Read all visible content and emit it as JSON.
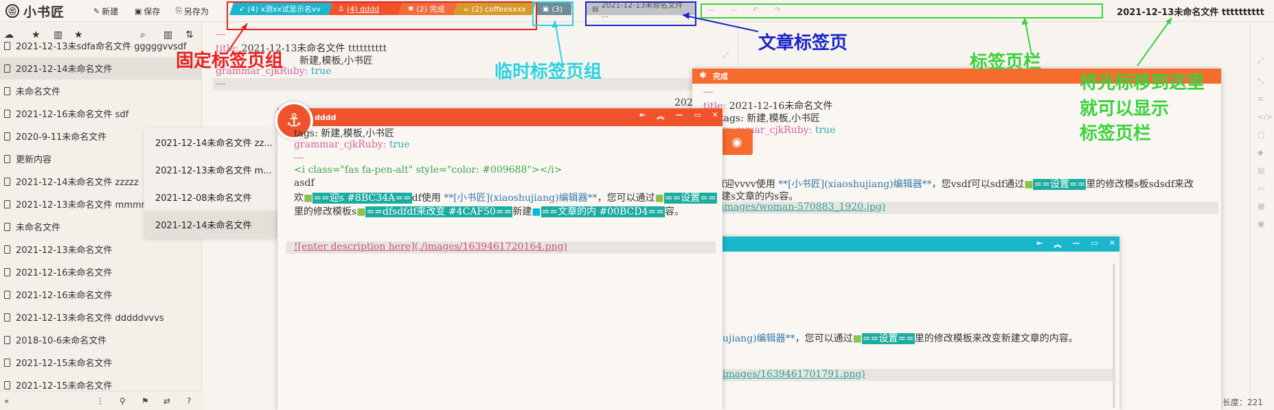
{
  "app": {
    "name": "小书匠",
    "logo_glyph": "㊂"
  },
  "toolbar": {
    "new_label": "新建",
    "save_label": "保存",
    "saveas_label": "另存为"
  },
  "tabs": [
    {
      "label": "(4) x测xx试显示名vv",
      "icon": "rocket-icon",
      "color": "#1bb5cc"
    },
    {
      "label": "(4) dddd",
      "icon": "anchor-icon",
      "color": "#f0522b"
    },
    {
      "label": "(2) 完成",
      "icon": "gear-icon",
      "color": "#f56a3c"
    },
    {
      "label": "(2) coffeexxxx",
      "icon": "coffee-icon",
      "color": "#d69a2a"
    },
    {
      "label": "(3)",
      "icon": "save-icon",
      "color": "#6e8c9a"
    },
    {
      "label": "2021-12-13未命名文件 ...",
      "icon": "file-icon",
      "color": "#bfc2c6"
    }
  ],
  "document_title": "2021-12-13未命名文件 tttttttttt",
  "sidebar": {
    "files": [
      {
        "label": "2021-12-13未sdfa命名文件 gggggvvsdf",
        "selected": false
      },
      {
        "label": "2021-12-14未命名文件",
        "selected": true
      },
      {
        "label": "未命名文件",
        "selected": false
      },
      {
        "label": "2021-12-16未命名文件 sdf",
        "selected": false
      },
      {
        "label": "2020-9-11未命名文件",
        "selected": false
      },
      {
        "label": "更新内容",
        "selected": false
      },
      {
        "label": "2021-12-14未命名文件 zzzzz",
        "selected": false
      },
      {
        "label": "2021-12-13未命名文件 mmmm",
        "selected": false
      },
      {
        "label": "未命名文件",
        "selected": false
      },
      {
        "label": "2021-12-13未命名文件",
        "selected": false
      },
      {
        "label": "2021-12-16未命名文件",
        "selected": false
      },
      {
        "label": "2021-12-16未命名文件",
        "selected": false
      },
      {
        "label": "2021-12-13未命名文件 dddddvvvs",
        "selected": false
      },
      {
        "label": "2018-10-6未命名文件",
        "selected": false
      },
      {
        "label": "2021-12-15未命名文件",
        "selected": false
      },
      {
        "label": "2021-12-15未命名文件",
        "selected": false
      }
    ]
  },
  "popup": {
    "items": [
      "2021-12-14未命名文件 zz...",
      "2021-12-13未命名文件 m...",
      "2021-12-08未命名文件",
      "2021-12-14未命名文件"
    ]
  },
  "editor": {
    "l1": "---",
    "l2_key": "title:",
    "l2_val": " 2021-12-13未命名文件 tttttttttt",
    "l3": "新建,模板,小书匠",
    "l4_key": "grammar_cjkRuby:",
    "l4_val": " true",
    "l5": "---",
    "partial": "202"
  },
  "win_dddd": {
    "title": "dddd",
    "tags": "tags: 新建,模板,小书匠",
    "ruby_key": "grammar_cjkRuby:",
    "ruby_val": " true",
    "sep": "---",
    "html": "<i class=\"fas fa-pen-alt\" style=\"color: #009688\"></i>",
    "asdf": "asdf",
    "p1a": "欢",
    "p1b": "==迎s #8BC34A==",
    "p1c": "df使用 ",
    "p1d": "**[小书匠](xiaoshujiang)编辑器**",
    "p1e": "，您可以通过",
    "p1f": "==设置==",
    "p2a": "里的修改模板s",
    "p2b": "==dfsdfdf来改变 #4CAF50==",
    "p2c": "新建",
    "p2d": "==文章的内 #00BCD4==",
    "p2e": "容。",
    "img": "![enter description here](./images/1639461720164.png)"
  },
  "win_done": {
    "title": "完成",
    "sep": "---",
    "title_line_key": "title:",
    "title_line_val": " 2021-12-16未命名文件",
    "tags_line": "tags: 新建,模板,小书匠",
    "ruby_line": "grammar_cjkRuby:",
    "ruby_val": " true",
    "p1a": "f迎vvvv使用 ",
    "p1b": "**[小书匠](xiaoshujiang)编辑器**",
    "p1c": "，您vsdf可以sdf通过",
    "p1d": "==设置==",
    "p1e": "里的修改模s板sdsdf来改",
    "p2": "建s文章的内s容。",
    "img": "images/woman-570883_1920.jpg)"
  },
  "win_blue": {
    "p1a": "ujiang)编辑器**",
    "p1b": "，您可以通过",
    "p1c": "==设置==",
    "p1d": "里的修改模板来改变新建文章的内容。",
    "img": "images/1639461701791.png)"
  },
  "status": {
    "length_label": "长度：221"
  },
  "annotations": {
    "fixed": "固定标签页组",
    "temp": "临时标签页组",
    "article": "文章标签页",
    "bar": "标签页栏",
    "hint1": "将光标移到这里",
    "hint2": "就可以显示",
    "hint3": "标签页栏"
  },
  "colors": {
    "red": "#e8201f",
    "cyan": "#27d3e0",
    "blue": "#1a24c8",
    "green": "#3bd13b",
    "orange": "#f66b2e",
    "teal": "#1bb5cc"
  }
}
